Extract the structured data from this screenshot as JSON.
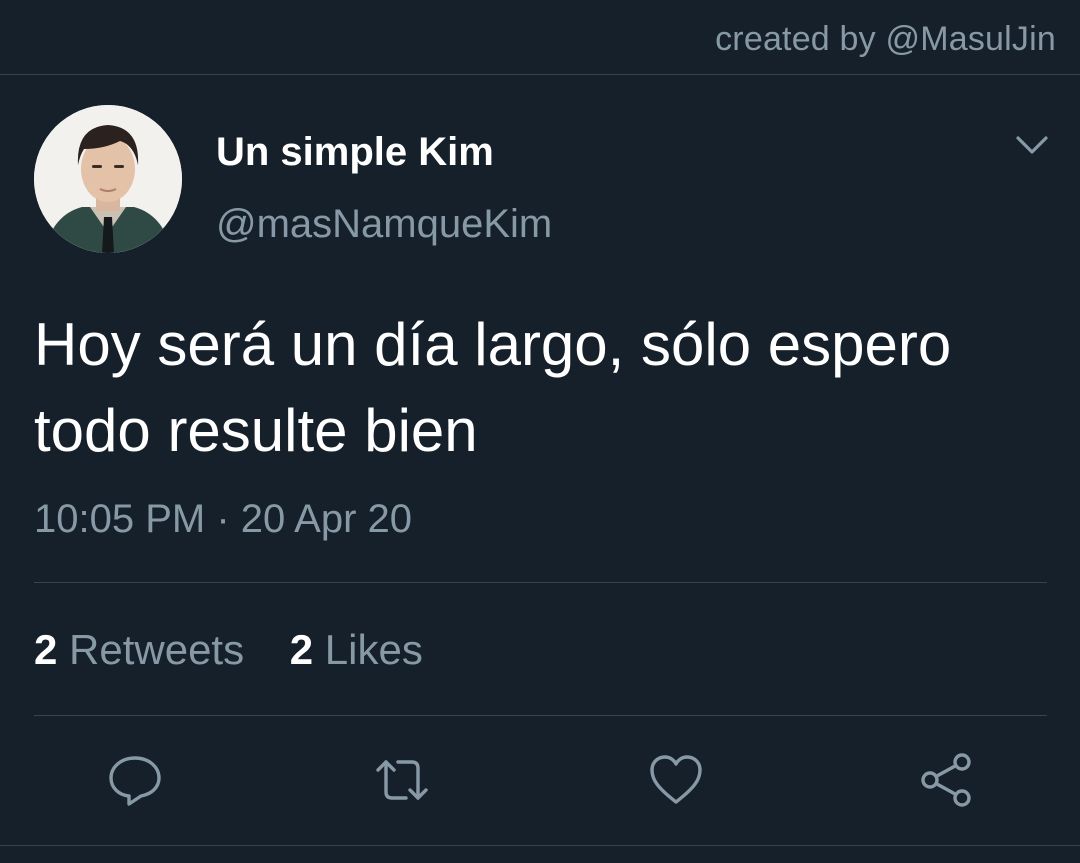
{
  "header": {
    "credit": "created by @MasulJin"
  },
  "tweet": {
    "display_name": "Un simple Kim",
    "handle": "@masNamqueKim",
    "text": "Hoy será un día largo, sólo espero todo resulte bien",
    "time": "10:05 PM",
    "separator": " · ",
    "date": "20 Apr 20"
  },
  "stats": {
    "retweets_count": "2",
    "retweets_label": " Retweets",
    "likes_count": "2",
    "likes_label": " Likes"
  },
  "actions": {
    "icons": [
      "reply-icon",
      "retweet-icon",
      "like-icon",
      "share-icon"
    ]
  },
  "colors": {
    "background": "#15202b",
    "secondary_text": "#8899a6",
    "divider": "#38444d",
    "primary_text": "#ffffff"
  }
}
